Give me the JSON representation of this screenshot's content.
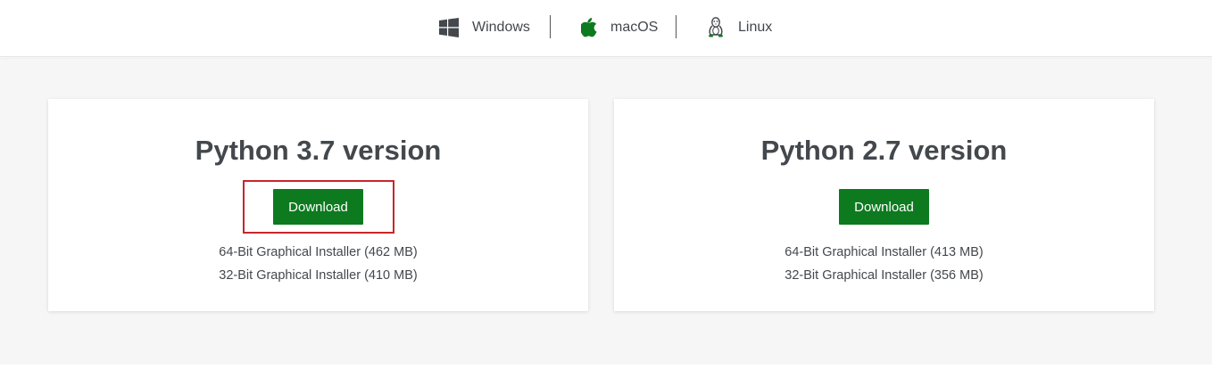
{
  "os_tabs": [
    {
      "label": "Windows",
      "icon": "windows-icon"
    },
    {
      "label": "macOS",
      "icon": "apple-icon"
    },
    {
      "label": "Linux",
      "icon": "linux-icon"
    }
  ],
  "cards": [
    {
      "title": "Python 3.7 version",
      "button_label": "Download",
      "highlighted": true,
      "installers": [
        "64-Bit Graphical Installer (462 MB)",
        "32-Bit Graphical Installer (410 MB)"
      ]
    },
    {
      "title": "Python 2.7 version",
      "button_label": "Download",
      "highlighted": false,
      "installers": [
        "64-Bit Graphical Installer (413 MB)",
        "32-Bit Graphical Installer (356 MB)"
      ]
    }
  ],
  "colors": {
    "button_green": "#0d7a1f",
    "highlight_red": "#c8262b",
    "text_dark": "#43484d",
    "background_gray": "#f6f6f6"
  }
}
